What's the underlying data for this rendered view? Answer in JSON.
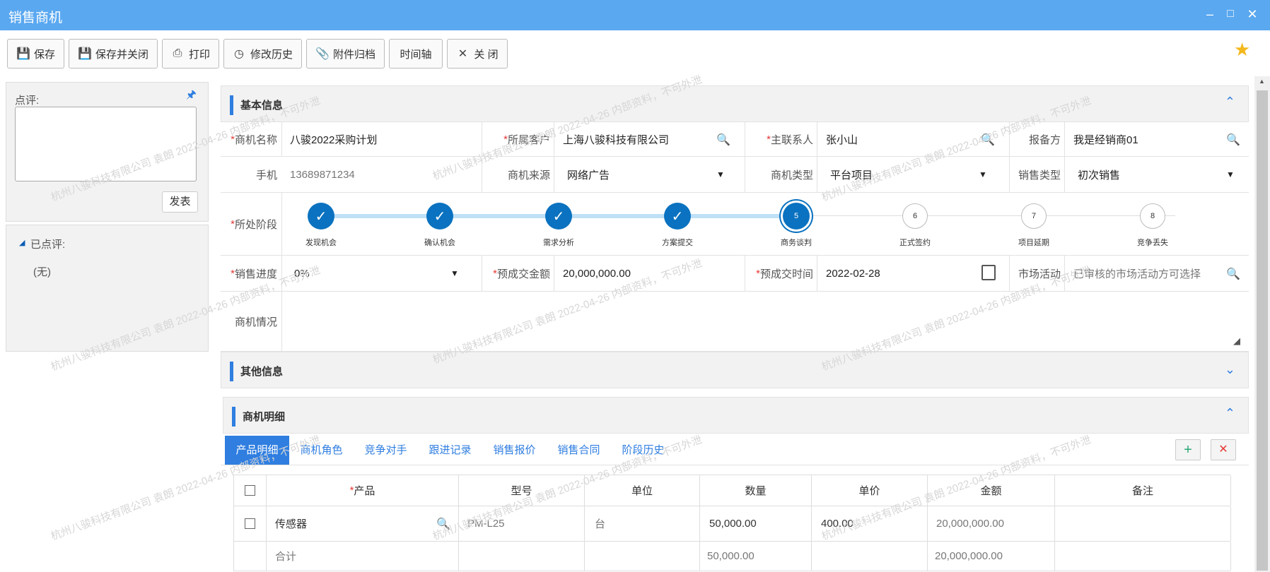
{
  "window": {
    "title": "销售商机"
  },
  "toolbar": {
    "save": "保存",
    "save_close": "保存并关闭",
    "print": "打印",
    "history": "修改历史",
    "attach": "附件归档",
    "timeline": "时间轴",
    "close": "关 闭"
  },
  "left": {
    "comment_label": "点评:",
    "publish": "发表",
    "reviewed_label": "已点评:",
    "reviewed_empty": "(无)"
  },
  "basic": {
    "title": "基本信息",
    "name_label": "商机名称",
    "name_value": "八骏2022采购计划",
    "customer_label": "所属客户",
    "customer_value": "上海八骏科技有限公司",
    "contact_label": "主联系人",
    "contact_value": "张小山",
    "filer_label": "报备方",
    "filer_value": "我是经销商01",
    "phone_label": "手机",
    "phone_value": "13689871234",
    "source_label": "商机来源",
    "source_value": "网络广告",
    "type_label": "商机类型",
    "type_value": "平台项目",
    "sales_type_label": "销售类型",
    "sales_type_value": "初次销售",
    "stage_label": "所处阶段",
    "stages": [
      {
        "num": "✓",
        "label": "发现机会",
        "state": "done"
      },
      {
        "num": "✓",
        "label": "确认机会",
        "state": "done"
      },
      {
        "num": "✓",
        "label": "需求分析",
        "state": "done"
      },
      {
        "num": "✓",
        "label": "方案提交",
        "state": "done"
      },
      {
        "num": "5",
        "label": "商务谈判",
        "state": "current"
      },
      {
        "num": "6",
        "label": "正式签约",
        "state": "todo"
      },
      {
        "num": "7",
        "label": "项目延期",
        "state": "todo"
      },
      {
        "num": "8",
        "label": "竞争丢失",
        "state": "todo"
      }
    ],
    "progress_label": "销售进度",
    "progress_value": "0%",
    "amount_label": "预成交金额",
    "amount_value": "20,000,000.00",
    "date_label": "预成交时间",
    "date_value": "2022-02-28",
    "market_label": "市场活动",
    "market_placeholder": "已审核的市场活动方可选择",
    "situation_label": "商机情况"
  },
  "other": {
    "title": "其他信息"
  },
  "detail": {
    "title": "商机明细",
    "tabs": [
      "产品明细",
      "商机角色",
      "竞争对手",
      "跟进记录",
      "销售报价",
      "销售合同",
      "阶段历史"
    ],
    "columns": [
      "产品",
      "型号",
      "单位",
      "数量",
      "单价",
      "金额",
      "备注"
    ],
    "rows": [
      {
        "product": "传感器",
        "model": "PM-L25",
        "unit": "台",
        "qty": "50,000.00",
        "price": "400.00",
        "amount": "20,000,000.00",
        "note": ""
      }
    ],
    "total_label": "合计",
    "total_qty": "50,000.00",
    "total_amount": "20,000,000.00"
  },
  "watermark": "杭州八骏科技有限公司 袁朗 2022-04-26 内部资料，不可外泄",
  "colors": {
    "titlebar": "#5aa8f0",
    "accent": "#2f7ee0",
    "stage_done": "#0a72c0",
    "star": "#f3b81c",
    "required": "#e53935"
  }
}
